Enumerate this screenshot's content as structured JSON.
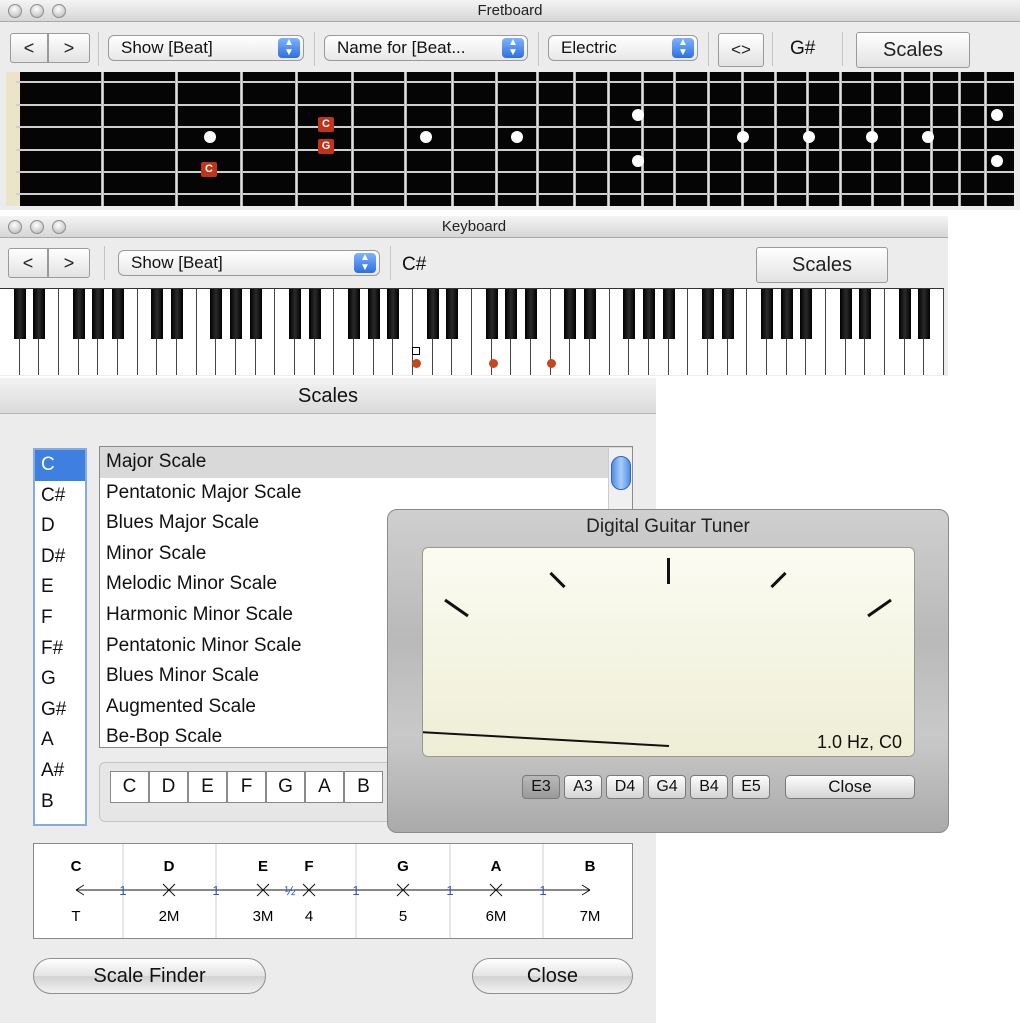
{
  "fretboard": {
    "title": "Fretboard",
    "back_label": "<",
    "forward_label": ">",
    "show_select": "Show [Beat]",
    "name_select": "Name for [Beat...",
    "guitar_select": "Electric",
    "swap_label": "<>",
    "current_note": "G#",
    "scales_button": "Scales",
    "notes": [
      "C",
      "G",
      "C"
    ]
  },
  "keyboard": {
    "title": "Keyboard",
    "back_label": "<",
    "forward_label": ">",
    "show_select": "Show [Beat]",
    "current_note": "C#",
    "scales_button": "Scales"
  },
  "scales": {
    "title": "Scales",
    "roots": [
      "C",
      "C#",
      "D",
      "D#",
      "E",
      "F",
      "F#",
      "G",
      "G#",
      "A",
      "A#",
      "B"
    ],
    "selected_root": "C",
    "scale_names": [
      "Major Scale",
      "Pentatonic Major Scale",
      "Blues Major Scale",
      "Minor Scale",
      "Melodic Minor Scale",
      "Harmonic Minor Scale",
      "Pentatonic Minor Scale",
      "Blues Minor Scale",
      "Augmented Scale",
      "Be-Bop Scale"
    ],
    "selected_scale": "Major Scale",
    "note_buttons": [
      "C",
      "D",
      "E",
      "F",
      "G",
      "A",
      "B"
    ],
    "interval_notes": [
      "C",
      "D",
      "E",
      "F",
      "G",
      "A",
      "B"
    ],
    "interval_steps": [
      "1",
      "1",
      "½",
      "1",
      "1",
      "1"
    ],
    "interval_degrees": [
      "T",
      "2M",
      "3M",
      "4",
      "5",
      "6M",
      "7M"
    ],
    "scale_finder_button": "Scale Finder",
    "close_button": "Close"
  },
  "tuner": {
    "title": "Digital Guitar Tuner",
    "reading": "1.0 Hz, C0",
    "strings": [
      "E3",
      "A3",
      "D4",
      "G4",
      "B4",
      "E5"
    ],
    "selected_string": "E3",
    "close_button": "Close"
  }
}
